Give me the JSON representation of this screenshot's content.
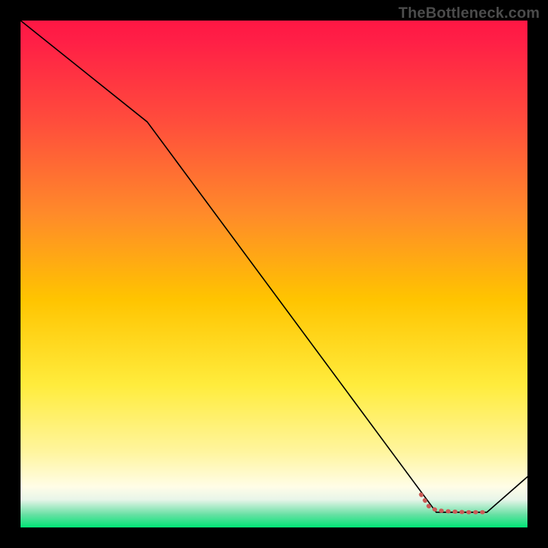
{
  "watermark": "TheBottleneck.com",
  "chart_data": {
    "type": "line",
    "title": "",
    "xlabel": "",
    "ylabel": "",
    "xlim": [
      0,
      100
    ],
    "ylim": [
      0,
      100
    ],
    "series": [
      {
        "name": "bottleneck-curve",
        "x": [
          0,
          25,
          82,
          92,
          100
        ],
        "values": [
          100,
          80,
          3,
          3,
          10
        ],
        "color": "#000000",
        "width": 1.8
      },
      {
        "name": "highlight-segment",
        "x": [
          79,
          80.5,
          82,
          84,
          86,
          88,
          90,
          92
        ],
        "values": [
          6.5,
          4.2,
          3.4,
          3.2,
          3.1,
          3.0,
          3.0,
          3.0
        ],
        "color": "#cc5b57",
        "width": 6,
        "dash": "1 9"
      }
    ],
    "gradient_stops": [
      {
        "offset": 0.0,
        "color": "#ff1744"
      },
      {
        "offset": 0.04,
        "color": "#ff1f46"
      },
      {
        "offset": 0.2,
        "color": "#ff4d3c"
      },
      {
        "offset": 0.38,
        "color": "#ff8a2a"
      },
      {
        "offset": 0.55,
        "color": "#ffc400"
      },
      {
        "offset": 0.72,
        "color": "#ffec3d"
      },
      {
        "offset": 0.85,
        "color": "#fff59d"
      },
      {
        "offset": 0.92,
        "color": "#fffde7"
      },
      {
        "offset": 0.945,
        "color": "#e8f5e9"
      },
      {
        "offset": 0.975,
        "color": "#66e0a3"
      },
      {
        "offset": 1.0,
        "color": "#00e676"
      }
    ]
  }
}
